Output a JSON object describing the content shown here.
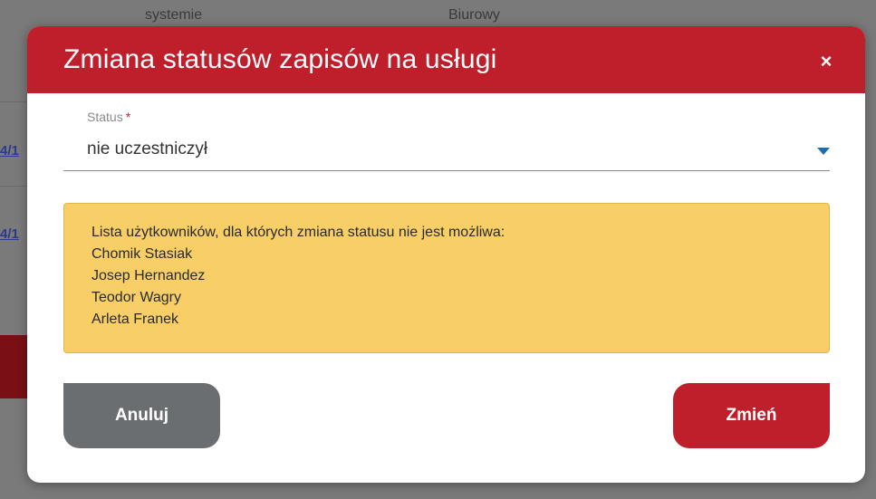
{
  "background": {
    "header_col1": "systemie",
    "header_col2": "Biurowy",
    "row_links": [
      "4/1",
      "4/1"
    ]
  },
  "modal": {
    "title": "Zmiana statusów zapisów na usługi",
    "close_glyph": "×",
    "status_field": {
      "label": "Status",
      "required_mark": "*",
      "value": "nie uczestniczył"
    },
    "warning": {
      "lines": [
        "Lista użytkowników, dla których zmiana statusu nie jest możliwa:",
        "Chomik Stasiak",
        "Josep Hernandez",
        "Teodor Wagry",
        "Arleta Franek"
      ]
    },
    "buttons": {
      "cancel_label": "Anuluj",
      "confirm_label": "Zmień"
    }
  },
  "colors": {
    "header": "#bf1e2b",
    "warning_bg": "#f8cf67",
    "cancel_btn": "#6b6e70",
    "confirm_btn": "#bf1e2b",
    "dropdown_arrow": "#1b6fb0"
  },
  "icons": {
    "close": "close-icon",
    "dropdown": "chevron-down-icon"
  }
}
